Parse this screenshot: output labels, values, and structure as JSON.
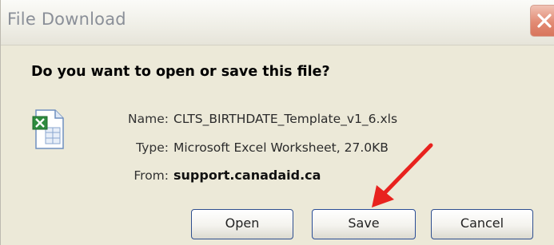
{
  "window": {
    "title": "File Download",
    "close_icon": "close-icon"
  },
  "prompt": {
    "question": "Do you want to open or save this file?"
  },
  "file": {
    "icon": "excel-file-icon",
    "name_label": "Name:",
    "name_value": "CLTS_BIRTHDATE_Template_v1_6.xls",
    "type_label": "Type:",
    "type_value": "Microsoft Excel Worksheet, 27.0KB",
    "from_label": "From:",
    "from_value": "support.canadaid.ca"
  },
  "buttons": {
    "open": "Open",
    "save": "Save",
    "cancel": "Cancel"
  },
  "annotation": {
    "arrow_icon": "red-arrow-icon",
    "arrow_color": "#e8221e",
    "points_to": "Save"
  },
  "colors": {
    "dialog_bg": "#ece9d8",
    "close_button": "#e28b74",
    "button_border": "#2f4f8f"
  }
}
